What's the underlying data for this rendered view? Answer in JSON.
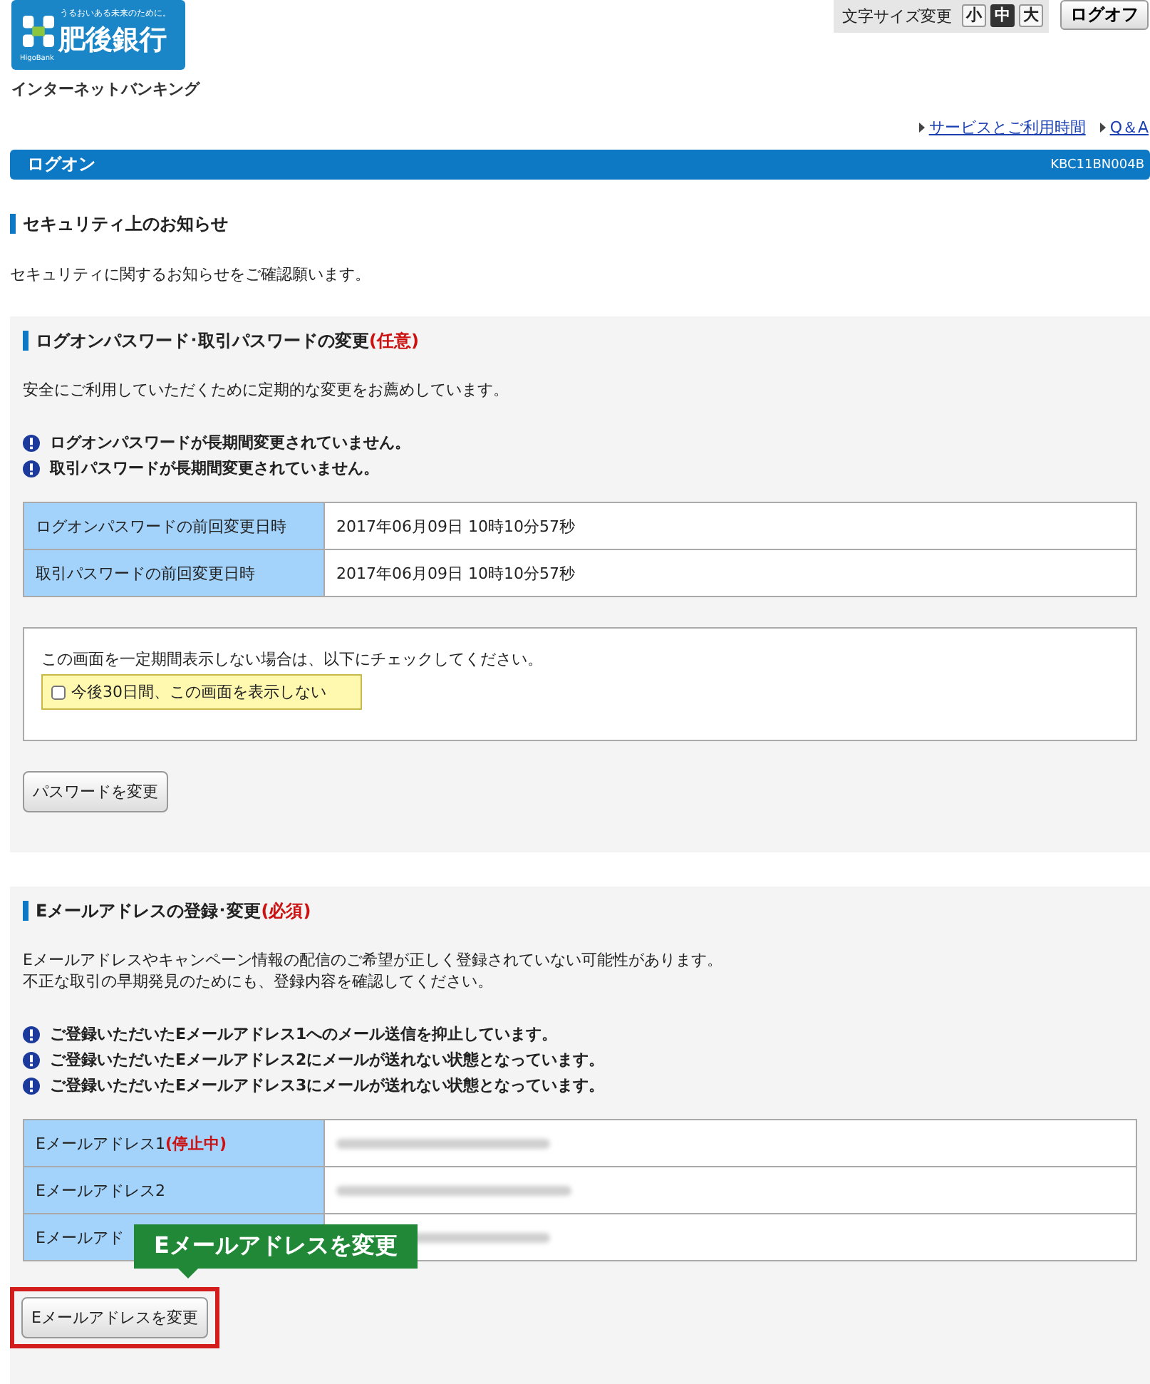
{
  "header": {
    "logo": {
      "tagline": "うるおいある未来のために。",
      "name": "肥後銀行",
      "sub": "HigoBank"
    },
    "service_name": "インターネットバンキング",
    "font_size": {
      "label": "文字サイズ変更",
      "options": [
        {
          "label": "小",
          "selected": false
        },
        {
          "label": "中",
          "selected": true
        },
        {
          "label": "大",
          "selected": false
        }
      ]
    },
    "logoff_button": "ログオフ"
  },
  "links": [
    "サービスとご利用時間",
    "Q＆A"
  ],
  "page_bar": {
    "title": "ログオン",
    "code": "KBC11BN004B"
  },
  "notice": {
    "heading": "セキュリティ上のお知らせ",
    "intro": "セキュリティに関するお知らせをご確認願います。"
  },
  "sections": [
    {
      "heading": "ログオンパスワード･取引パスワードの変更",
      "tag": "(任意)",
      "messages": [
        "安全にご利用していただくために定期的な変更をお薦めしています。"
      ],
      "alerts": [
        "ログオンパスワードが長期間変更されていません。",
        "取引パスワードが長期間変更されていません。"
      ],
      "rows": [
        {
          "kind": "text",
          "label": "ログオンパスワードの前回変更日時",
          "value": "2017年06月09日 10時10分57秒"
        },
        {
          "kind": "text",
          "label": "取引パスワードの前回変更日時",
          "value": "2017年06月09日 10時10分57秒"
        }
      ],
      "checkbox": {
        "prompt": "この画面を一定期間表示しない場合は、以下にチェックしてください。",
        "label": "今後30日間、この画面を表示しない",
        "checked": false
      },
      "button": "パスワードを変更",
      "highlighted": false
    },
    {
      "heading": "Eメールアドレスの登録･変更",
      "tag": "(必須)",
      "messages": [
        "Eメールアドレスやキャンペーン情報の配信のご希望が正しく登録されていない可能性があります。",
        "不正な取引の早期発見のためにも、登録内容を確認してください。"
      ],
      "alerts": [
        "ご登録いただいたEメールアドレス1へのメール送信を抑止しています。",
        "ご登録いただいたEメールアドレス2にメールが送れない状態となっています。",
        "ご登録いただいたEメールアドレス3にメールが送れない状態となっています。"
      ],
      "rows": [
        {
          "kind": "blurred",
          "label": "Eメールアドレス1",
          "status": "(停止中)"
        },
        {
          "kind": "blurred",
          "label": "Eメールアドレス2"
        },
        {
          "kind": "blurred",
          "label": "Eメールアド"
        }
      ],
      "button": "Eメールアドレスを変更",
      "highlighted": true,
      "callout": "Eメールアドレスを変更"
    }
  ]
}
